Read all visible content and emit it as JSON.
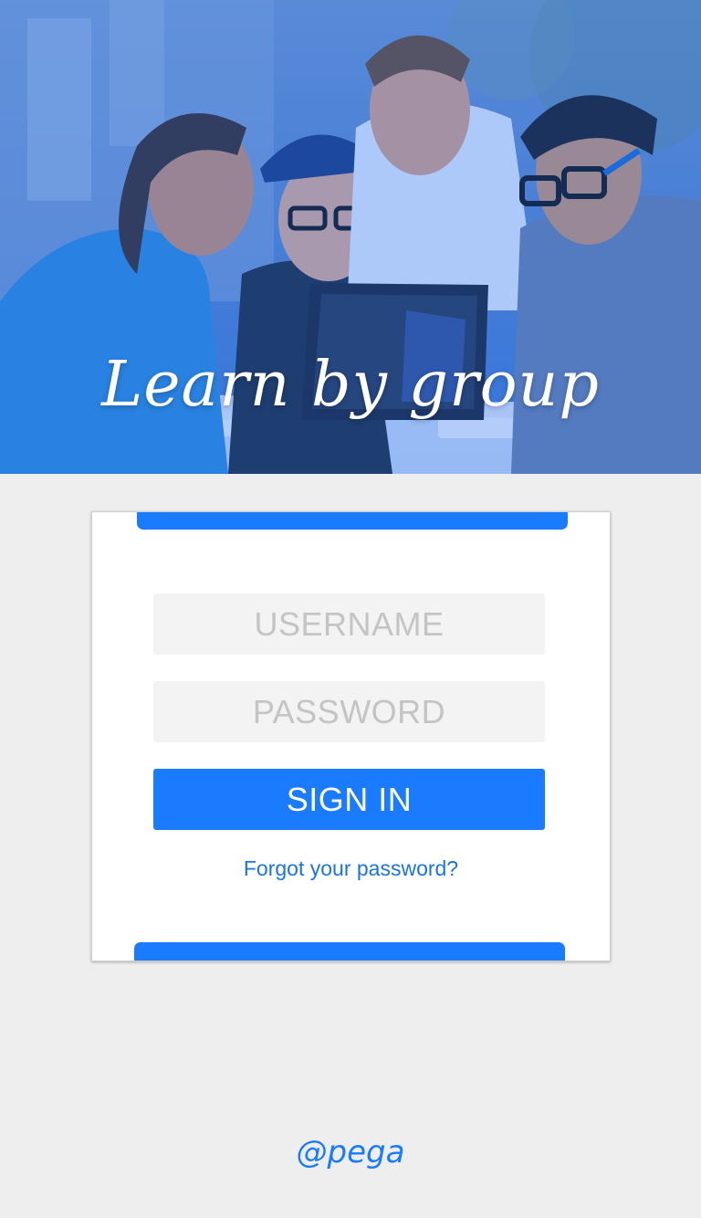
{
  "hero": {
    "title": "Learn by group",
    "image": "students-group-with-laptop-photo"
  },
  "login": {
    "username_placeholder": "USERNAME",
    "password_placeholder": "PASSWORD",
    "sign_in_label": "SIGN IN",
    "forgot_password_label": "Forgot your password?"
  },
  "footer": {
    "brand": "@pega"
  },
  "colors": {
    "accent": "#1a7bff",
    "background": "#eeeeee",
    "field_background": "#f3f3f3",
    "placeholder": "#c4c4c4",
    "link": "#1a73e8"
  }
}
